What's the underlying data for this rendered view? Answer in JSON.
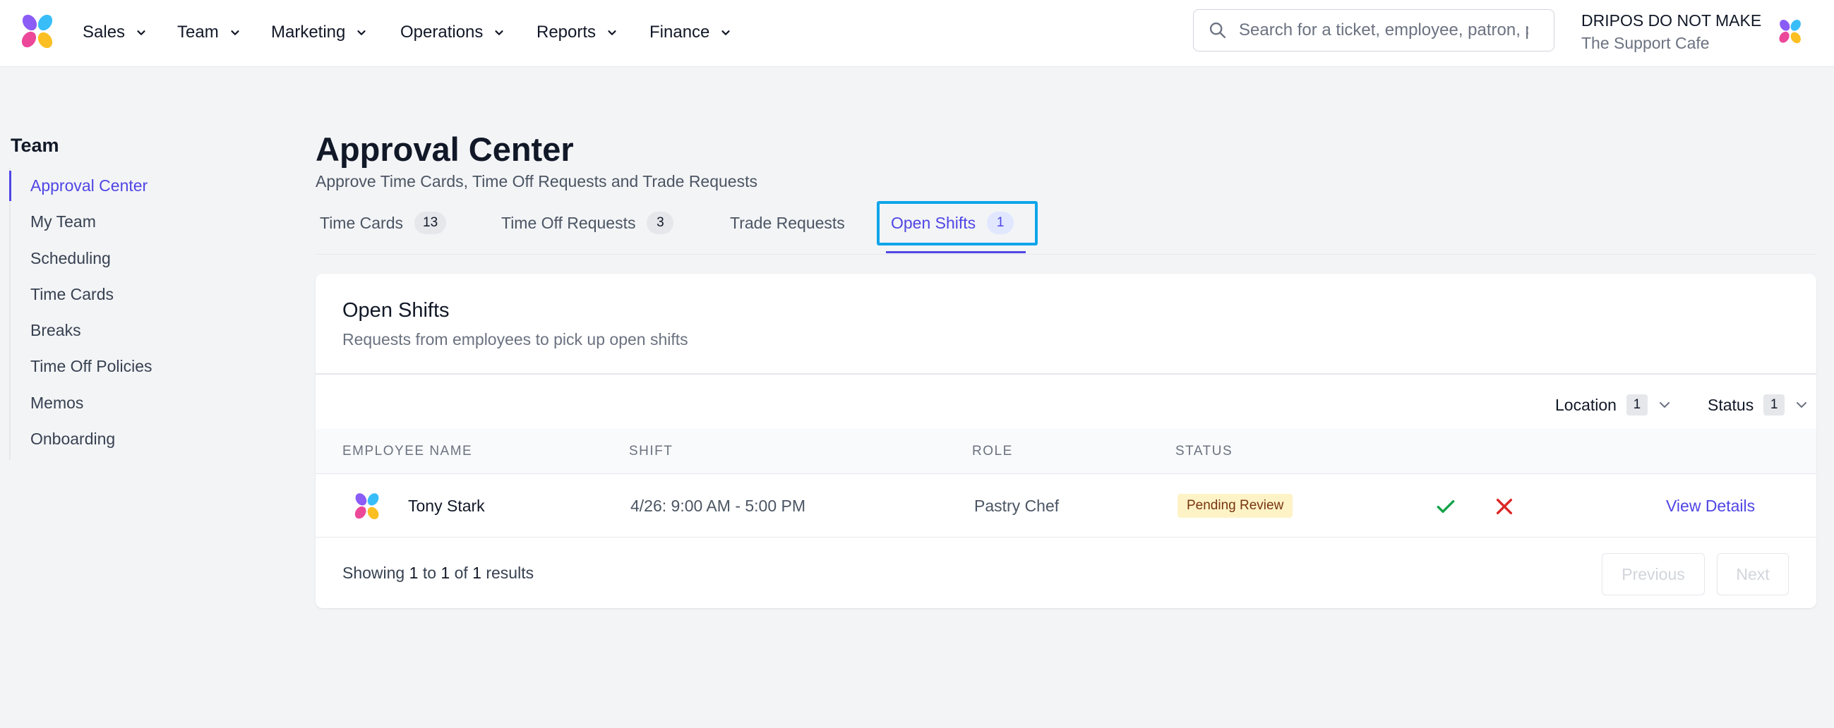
{
  "colors": {
    "accent": "#4f46e5",
    "highlight": "#0ea5e9",
    "approve": "#16a34a",
    "deny": "#dc2626",
    "pending_bg": "#fef3c7"
  },
  "nav": {
    "items": [
      {
        "label": "Sales"
      },
      {
        "label": "Team"
      },
      {
        "label": "Marketing"
      },
      {
        "label": "Operations"
      },
      {
        "label": "Reports"
      },
      {
        "label": "Finance"
      }
    ],
    "search_placeholder": "Search for a ticket, employee, patron, p",
    "account": {
      "org": "DRIPOS DO NOT MAKE",
      "location": "The Support Cafe"
    }
  },
  "sidebar": {
    "title": "Team",
    "items": [
      {
        "label": "Approval Center",
        "active": true
      },
      {
        "label": "My Team"
      },
      {
        "label": "Scheduling"
      },
      {
        "label": "Time Cards"
      },
      {
        "label": "Breaks"
      },
      {
        "label": "Time Off Policies"
      },
      {
        "label": "Memos"
      },
      {
        "label": "Onboarding"
      }
    ]
  },
  "header": {
    "title": "Approval Center",
    "subtitle": "Approve Time Cards, Time Off Requests and Trade Requests"
  },
  "tabs": [
    {
      "label": "Time Cards",
      "count": "13"
    },
    {
      "label": "Time Off Requests",
      "count": "3"
    },
    {
      "label": "Trade Requests"
    },
    {
      "label": "Open Shifts",
      "count": "1",
      "active": true
    }
  ],
  "card": {
    "title": "Open Shifts",
    "subtitle": "Requests from employees to pick up open shifts",
    "filters": [
      {
        "label": "Location",
        "count": "1"
      },
      {
        "label": "Status",
        "count": "1"
      }
    ],
    "columns": [
      "Employee Name",
      "Shift",
      "Role",
      "Status"
    ],
    "rows": [
      {
        "employee": "Tony Stark",
        "shift": "4/26: 9:00 AM - 5:00 PM",
        "role": "Pastry Chef",
        "status": "Pending Review",
        "link": "View Details"
      }
    ],
    "footer": {
      "showing": "Showing",
      "from": "1",
      "to_word": "to",
      "to": "1",
      "of_word": "of",
      "total": "1",
      "results_word": "results"
    },
    "pagination": {
      "previous": "Previous",
      "next": "Next"
    }
  }
}
